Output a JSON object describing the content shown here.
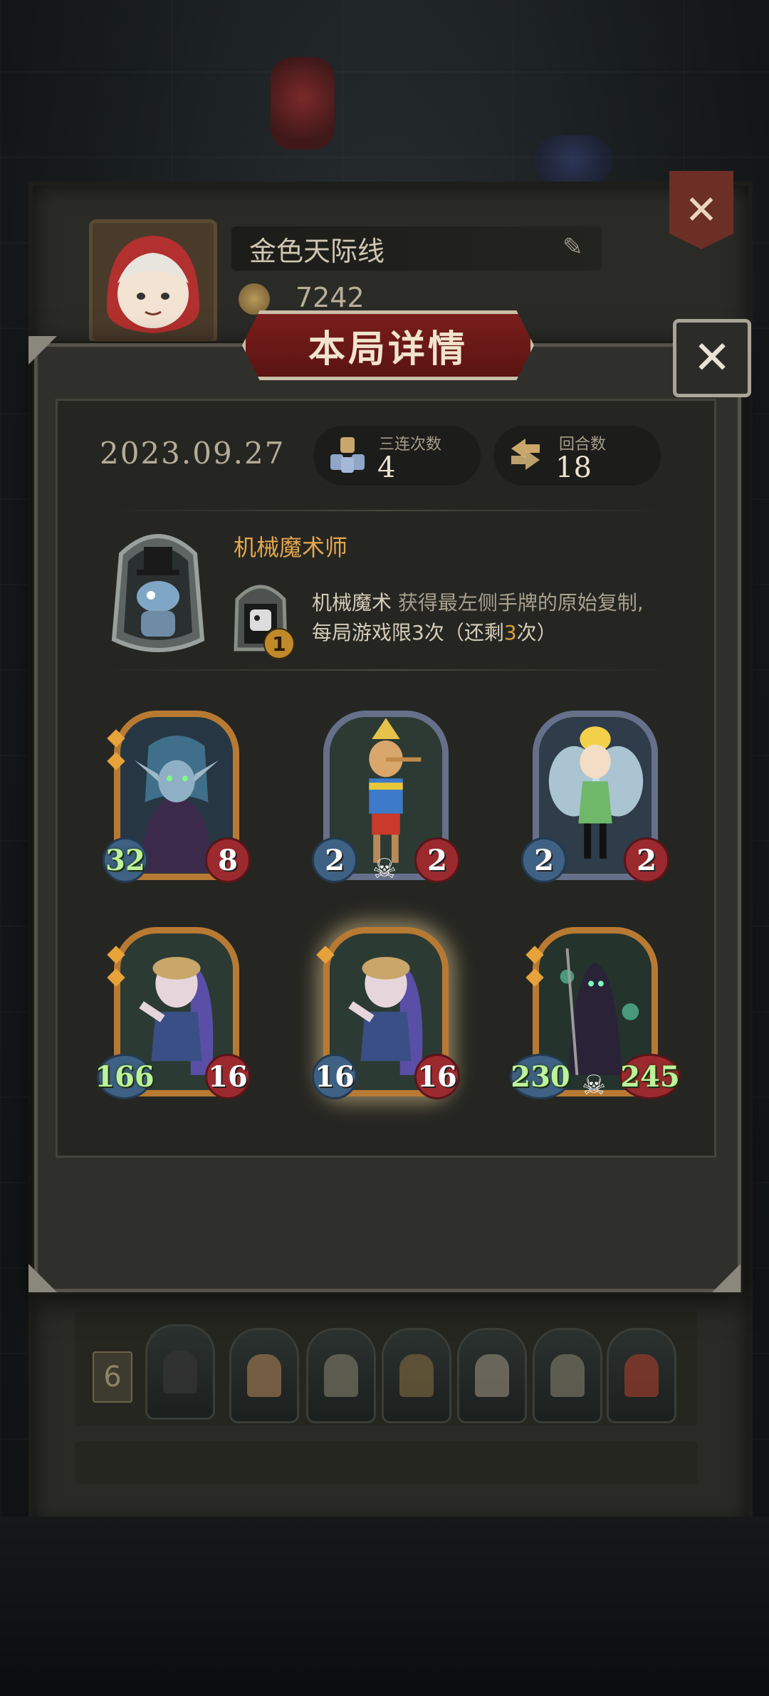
{
  "profile": {
    "name": "金色天际线",
    "coins": "7242",
    "rank": "6"
  },
  "modal": {
    "title": "本局详情",
    "date": "2023.09.27",
    "stats": {
      "triples_label": "三连次数",
      "triples_value": "4",
      "rounds_label": "回合数",
      "rounds_value": "18"
    },
    "hero": {
      "name": "机械魔术师",
      "skill_level": "1",
      "skill_name": "机械魔术",
      "skill_text_1": " 获得最左侧手牌的原始复制,",
      "skill_text_2": "每局游戏限3次（还剩",
      "skill_remaining": "3",
      "skill_text_3": "次）"
    },
    "cards": [
      {
        "attack": "32",
        "health": "8",
        "frame": "gold"
      },
      {
        "attack": "2",
        "health": "2",
        "frame": "silver"
      },
      {
        "attack": "2",
        "health": "2",
        "frame": "silver"
      },
      {
        "attack": "166",
        "health": "16",
        "frame": "gold"
      },
      {
        "attack": "16",
        "health": "16",
        "frame": "gold"
      },
      {
        "attack": "230",
        "health": "245",
        "frame": "gold"
      }
    ]
  },
  "icons": {
    "close": "close-icon",
    "pencil": "pencil-icon",
    "coin": "coin-icon",
    "skull": "skull-icon",
    "triple": "triple-icon",
    "rounds": "rounds-icon"
  },
  "colors": {
    "title_banner": "#7a1e1b",
    "hero_name": "#e3a64f",
    "attack_badge": "#3f6183",
    "health_badge": "#9b2a2f",
    "buffed_number": "#bdf29a",
    "gold_frame": "#b87a33",
    "silver_frame": "#67708a"
  }
}
